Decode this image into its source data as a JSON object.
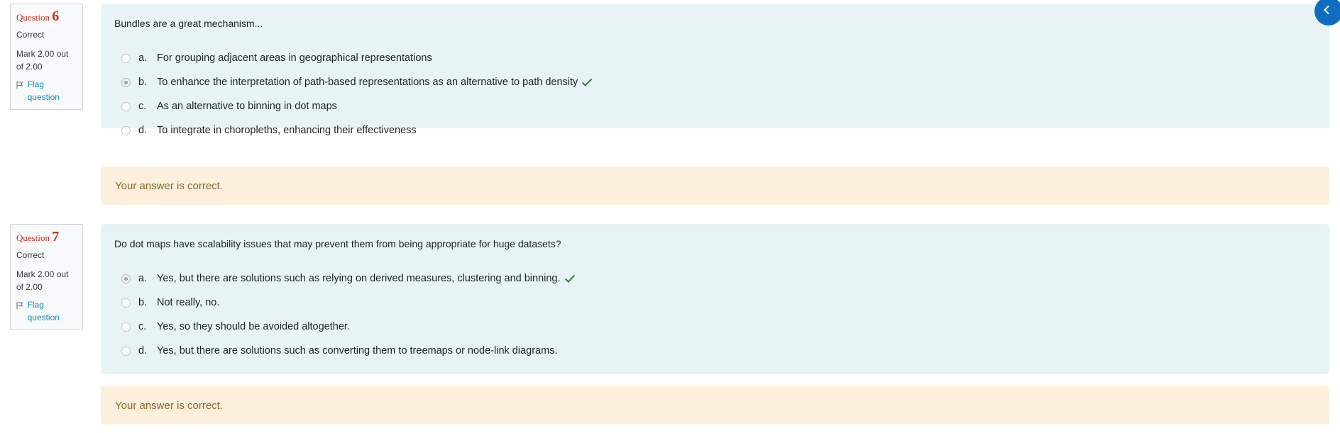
{
  "questions": [
    {
      "label": "Question",
      "number": "6",
      "state": "Correct",
      "grade": "Mark 2.00 out of 2.00",
      "flag_label": "Flag question",
      "text": "Bundles are a great mechanism...",
      "options": [
        {
          "letter": "a.",
          "text": "For grouping adjacent areas in geographical representations",
          "selected": false,
          "correct": false
        },
        {
          "letter": "b.",
          "text": "To enhance the interpretation of path-based representations as an alternative to path density",
          "selected": true,
          "correct": true
        },
        {
          "letter": "c.",
          "text": "As an alternative to binning in dot maps",
          "selected": false,
          "correct": false
        },
        {
          "letter": "d.",
          "text": "To integrate in choropleths, enhancing their effectiveness",
          "selected": false,
          "correct": false
        }
      ],
      "feedback": "Your answer is correct."
    },
    {
      "label": "Question",
      "number": "7",
      "state": "Correct",
      "grade": "Mark 2.00 out of 2.00",
      "flag_label": "Flag question",
      "text": "Do dot maps have scalability issues that may prevent them from being appropriate for huge datasets?",
      "options": [
        {
          "letter": "a.",
          "text": "Yes, but there are solutions such as relying on derived measures, clustering and binning.",
          "selected": true,
          "correct": true
        },
        {
          "letter": "b.",
          "text": "Not really, no.",
          "selected": false,
          "correct": false
        },
        {
          "letter": "c.",
          "text": "Yes, so they should be avoided altogether.",
          "selected": false,
          "correct": false
        },
        {
          "letter": "d.",
          "text": "Yes, but there are solutions such as converting them to treemaps or node-link diagrams.",
          "selected": false,
          "correct": false
        }
      ],
      "feedback": "Your answer is correct."
    }
  ],
  "colors": {
    "question_number": "#ca3120",
    "correct_check": "#357a32",
    "flag_link": "#0f8fbf",
    "formulation_bg": "#e7f3f5",
    "feedback_bg": "#fcefdc",
    "feedback_text": "#8e662e",
    "drawer_toggle": "#0f6cbf"
  },
  "icons": {
    "flag": "flag-icon",
    "correct": "check-icon",
    "drawer": "chevron-left-icon"
  }
}
